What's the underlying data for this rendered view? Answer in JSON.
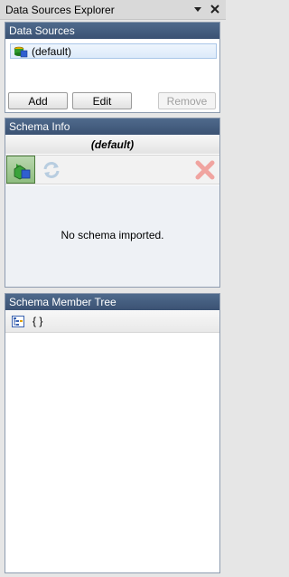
{
  "window": {
    "title": "Data Sources Explorer",
    "dropdown_icon": "dropdown-arrow-icon",
    "close_icon": "close-icon"
  },
  "data_sources": {
    "header": "Data Sources",
    "items": [
      {
        "label": "(default)",
        "icon": "database-icon",
        "selected": true
      }
    ],
    "buttons": {
      "add": "Add",
      "edit": "Edit",
      "remove": "Remove"
    }
  },
  "schema_info": {
    "header": "Schema Info",
    "schema_name": "(default)",
    "toolbar": [
      {
        "icon": "import-schema-icon",
        "active": true
      },
      {
        "icon": "refresh-icon",
        "enabled": false
      },
      {
        "icon": "delete-icon",
        "enabled": false
      }
    ],
    "empty_message": "No schema imported."
  },
  "schema_member_tree": {
    "header": "Schema Member Tree",
    "root_label": "{ }",
    "root_icon": "tree-view-icon"
  },
  "colors": {
    "panel_header": "#3b5273",
    "selection": "#dceafa",
    "background": "#e6e6e6"
  }
}
